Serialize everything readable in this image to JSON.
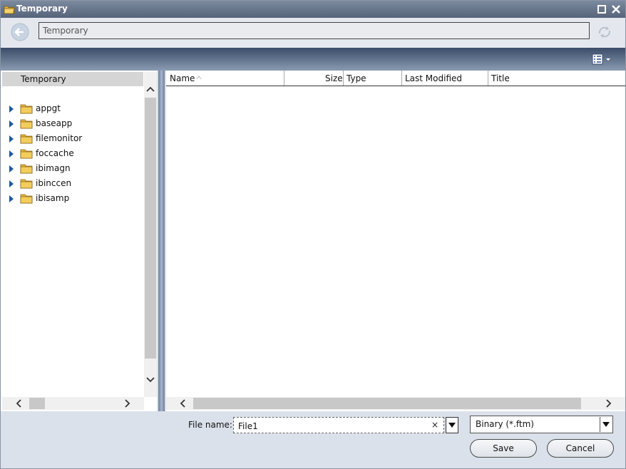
{
  "window": {
    "title": "Temporary"
  },
  "address": {
    "path": "Temporary"
  },
  "tree": {
    "root": "Temporary",
    "items": [
      {
        "label": "appgt"
      },
      {
        "label": "baseapp"
      },
      {
        "label": "filemonitor"
      },
      {
        "label": "foccache"
      },
      {
        "label": "ibimagn"
      },
      {
        "label": "ibinccen"
      },
      {
        "label": "ibisamp"
      }
    ]
  },
  "file_list": {
    "columns": [
      "Name",
      "Size",
      "Type",
      "Last Modified",
      "Title"
    ],
    "rows": []
  },
  "bottom": {
    "file_name_label": "File name:",
    "file_name_value": "File1",
    "clear_glyph": "×",
    "file_type_value": "Binary (*.ftm)",
    "save_label": "Save",
    "cancel_label": "Cancel"
  },
  "colors": {
    "titlebar": "#56647a",
    "toolbar": "#3a4c68",
    "folder": "#e7b53a",
    "tree_arrow": "#1c5a9e"
  }
}
